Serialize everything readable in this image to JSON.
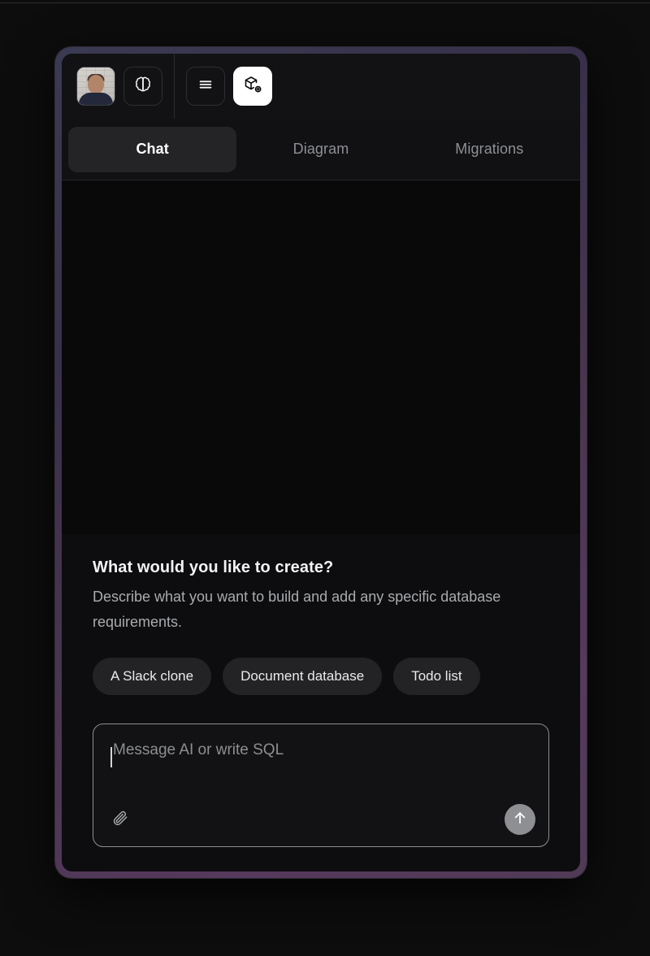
{
  "app": {
    "accent_border": "#56395c",
    "panel_bg": "#111113",
    "canvas_bg": "#09090a"
  },
  "toolbar": {
    "avatar": {
      "name": "user-avatar",
      "alt": "User profile photo"
    },
    "buttons": [
      {
        "id": "brain",
        "icon": "brain-icon",
        "label": "AI Brain",
        "active": false
      },
      {
        "id": "menu",
        "icon": "hamburger-menu-icon",
        "label": "Menu",
        "active": false
      },
      {
        "id": "new-project",
        "icon": "package-plus-icon",
        "label": "New project",
        "active": true
      }
    ]
  },
  "tabs": [
    {
      "label": "Chat",
      "active": true
    },
    {
      "label": "Diagram",
      "active": false
    },
    {
      "label": "Migrations",
      "active": false
    }
  ],
  "prompt": {
    "title": "What would you like to create?",
    "subtitle": "Describe what you want to build and add any specific database requirements.",
    "suggestions": [
      "A Slack clone",
      "Document database",
      "Todo list"
    ]
  },
  "composer": {
    "placeholder": "Message AI or write SQL",
    "value": "",
    "attach_label": "Attach file",
    "send_label": "Send message"
  }
}
